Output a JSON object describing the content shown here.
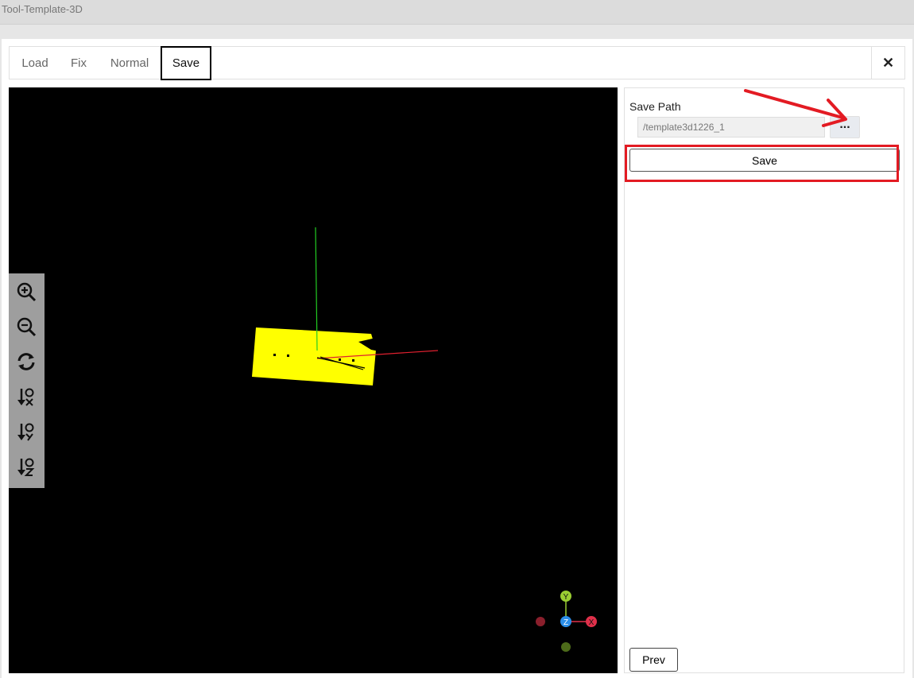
{
  "window": {
    "title": "Tool-Template-3D"
  },
  "tabs": [
    {
      "label": "Load"
    },
    {
      "label": "Fix"
    },
    {
      "label": "Normal"
    },
    {
      "label": "Save"
    }
  ],
  "active_tab": "Save",
  "close": {
    "glyph": "✕",
    "icon": "close-icon"
  },
  "toolbar": {
    "tools": [
      {
        "icon": "zoom-in-icon"
      },
      {
        "icon": "zoom-out-icon"
      },
      {
        "icon": "reset-view-icon"
      },
      {
        "icon": "sort-x-icon"
      },
      {
        "icon": "sort-y-icon"
      },
      {
        "icon": "sort-z-icon"
      }
    ]
  },
  "viewport": {
    "background": "#000000",
    "object_color": "#ffff00",
    "axis_colors": {
      "x": "#e0202f",
      "y": "#22cc22",
      "z": "#2b8ee8"
    },
    "gizmo_labels": {
      "x": "X",
      "y": "Y",
      "z": "Z"
    }
  },
  "panel": {
    "save_path_label": "Save Path",
    "save_path_value": "/template3d1226_1",
    "browse_label": "...",
    "save_label": "Save",
    "prev_label": "Prev"
  },
  "annotation_color": "#e31b23"
}
